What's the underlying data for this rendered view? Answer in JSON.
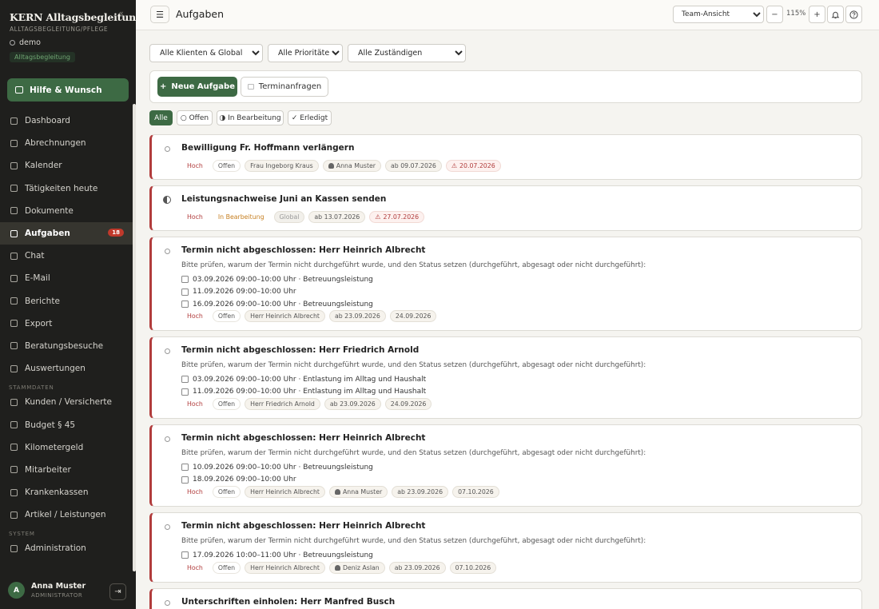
{
  "sidebar": {
    "brand_title": "KERN Alltagsbegleitung",
    "brand_subtitle": "ALLTAGSBEGLEITUNG/PFLEGE",
    "collapse_icon": "«",
    "tenant": "demo",
    "tenant_badge": "Alltagsbegleitung",
    "help_button": "Hilfe & Wunsch",
    "nav": [
      {
        "label": "Dashboard"
      },
      {
        "label": "Abrechnungen"
      },
      {
        "label": "Kalender"
      },
      {
        "label": "Tätigkeiten heute"
      },
      {
        "label": "Dokumente"
      },
      {
        "label": "Aufgaben",
        "badge": "18",
        "active": true
      },
      {
        "label": "Chat"
      },
      {
        "label": "E-Mail"
      },
      {
        "label": "Berichte"
      },
      {
        "label": "Export"
      },
      {
        "label": "Beratungsbesuche"
      },
      {
        "label": "Auswertungen"
      }
    ],
    "section_stammdaten": "STAMMDATEN",
    "stammdaten": [
      {
        "label": "Kunden / Versicherte"
      },
      {
        "label": "Budget § 45"
      },
      {
        "label": "Kilometergeld"
      },
      {
        "label": "Mitarbeiter"
      },
      {
        "label": "Krankenkassen"
      },
      {
        "label": "Artikel / Leistungen"
      }
    ],
    "section_system": "SYSTEM",
    "system": [
      {
        "label": "Administration"
      }
    ],
    "user": {
      "initial": "A",
      "name": "Anna Muster",
      "role": "ADMINISTRATOR"
    }
  },
  "topbar": {
    "title": "Aufgaben",
    "view_select": "Team-Ansicht",
    "zoom_out": "−",
    "zoom_level": "115%",
    "zoom_in": "+"
  },
  "filters": {
    "client": "Alle Klienten & Global",
    "priority": "Alle Prioritäten",
    "assignee": "Alle Zuständigen"
  },
  "actions": {
    "new_task": "Neue Aufgabe",
    "appointment_requests": "Terminanfragen"
  },
  "status_tabs": {
    "all": "Alle",
    "open": "○ Offen",
    "in_progress": "◑ In Bearbeitung",
    "done": "✓ Erledigt"
  },
  "tasks": [
    {
      "title": "Bewilligung Fr. Hoffmann verlängern",
      "priority": "Hoch",
      "status": "Offen",
      "client": "Frau Ingeborg Kraus",
      "assignee": "Anna Muster",
      "start": "ab 09.07.2026",
      "due": "20.07.2026"
    },
    {
      "title": "Leistungsnachweise Juni an Kassen senden",
      "priority": "Hoch",
      "status": "In Bearbeitung",
      "client": "Global",
      "start": "ab 13.07.2026",
      "due": "27.07.2026"
    },
    {
      "title": "Termin nicht abgeschlossen: Herr Heinrich Albrecht",
      "description": "Bitte prüfen, warum der Termin nicht durchgeführt wurde, und den Status setzen (durchgeführt, abgesagt oder nicht durchgeführt):",
      "checklist": [
        "03.09.2026 09:00–10:00 Uhr · Betreuungsleistung",
        "11.09.2026 09:00–10:00 Uhr",
        "16.09.2026 09:00–10:00 Uhr · Betreuungsleistung"
      ],
      "priority": "Hoch",
      "status": "Offen",
      "client": "Herr Heinrich Albrecht",
      "start": "ab 23.09.2026",
      "due": "24.09.2026"
    },
    {
      "title": "Termin nicht abgeschlossen: Herr Friedrich Arnold",
      "description": "Bitte prüfen, warum der Termin nicht durchgeführt wurde, und den Status setzen (durchgeführt, abgesagt oder nicht durchgeführt):",
      "checklist": [
        "03.09.2026 09:00–10:00 Uhr · Entlastung im Alltag und Haushalt",
        "11.09.2026 09:00–10:00 Uhr · Entlastung im Alltag und Haushalt"
      ],
      "priority": "Hoch",
      "status": "Offen",
      "client": "Herr Friedrich Arnold",
      "start": "ab 23.09.2026",
      "due": "24.09.2026"
    },
    {
      "title": "Termin nicht abgeschlossen: Herr Heinrich Albrecht",
      "description": "Bitte prüfen, warum der Termin nicht durchgeführt wurde, und den Status setzen (durchgeführt, abgesagt oder nicht durchgeführt):",
      "checklist": [
        "10.09.2026 09:00–10:00 Uhr · Betreuungsleistung",
        "18.09.2026 09:00–10:00 Uhr"
      ],
      "priority": "Hoch",
      "status": "Offen",
      "client": "Herr Heinrich Albrecht",
      "assignee": "Anna Muster",
      "start": "ab 23.09.2026",
      "due": "07.10.2026"
    },
    {
      "title": "Termin nicht abgeschlossen: Herr Heinrich Albrecht",
      "description": "Bitte prüfen, warum der Termin nicht durchgeführt wurde, und den Status setzen (durchgeführt, abgesagt oder nicht durchgeführt):",
      "checklist": [
        "17.09.2026 10:00–11:00 Uhr · Betreuungsleistung"
      ],
      "priority": "Hoch",
      "status": "Offen",
      "client": "Herr Heinrich Albrecht",
      "assignee": "Deniz Aslan",
      "start": "ab 23.09.2026",
      "due": "07.10.2026"
    },
    {
      "title": "Unterschriften einholen: Herr Manfred Busch"
    }
  ],
  "colors": {
    "accent": "#3d6a44",
    "sidebar_bg": "#1f1f1d",
    "priority_red": "#b13c3c",
    "in_progress_orange": "#c67f21"
  }
}
